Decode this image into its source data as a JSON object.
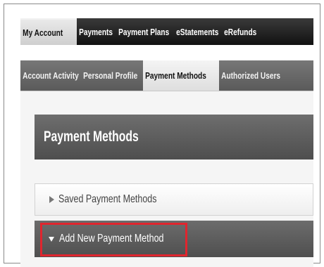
{
  "top_tabs": [
    {
      "label": "My Account",
      "active": true
    },
    {
      "label": "Payments",
      "active": false
    },
    {
      "label": "Payment Plans",
      "active": false
    },
    {
      "label": "eStatements",
      "active": false
    },
    {
      "label": "eRefunds",
      "active": false
    }
  ],
  "sub_tabs": [
    {
      "label": "Account Activity",
      "active": false
    },
    {
      "label": "Personal Profile",
      "active": false
    },
    {
      "label": "Payment Methods",
      "active": true
    },
    {
      "label": "Authorized Users",
      "active": false
    }
  ],
  "panel": {
    "title": "Payment Methods",
    "saved_label": "Saved Payment Methods",
    "addnew_label": "Add New Payment Method"
  },
  "colors": {
    "highlight": "#e0252e",
    "topbar": "#1a1a1a",
    "subbar": "#666666"
  }
}
